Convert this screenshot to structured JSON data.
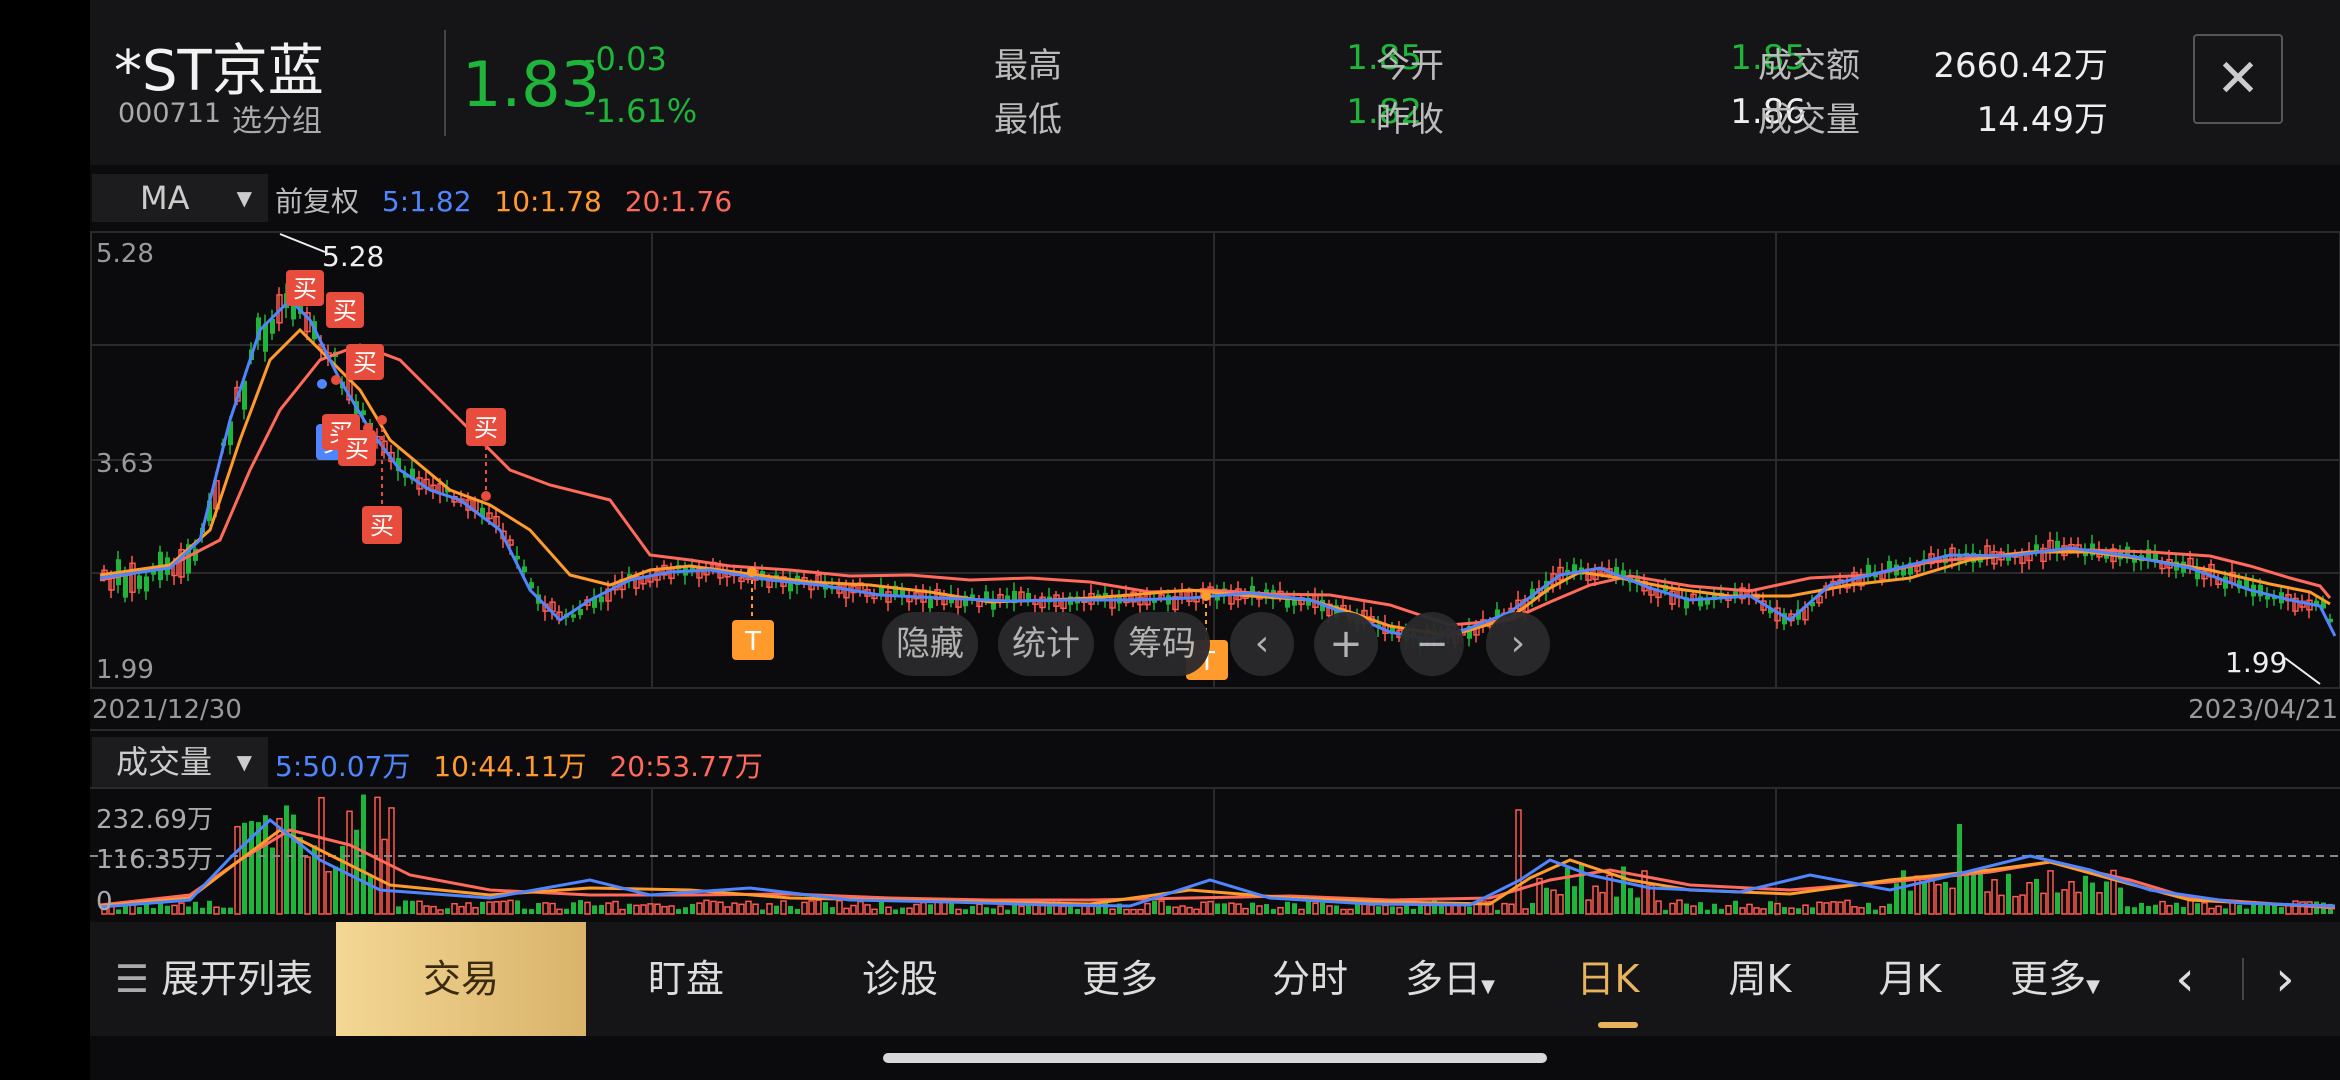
{
  "header": {
    "name": "*ST京蓝",
    "code": "000711",
    "group": "选分组",
    "price": "1.83",
    "change": "-0.03",
    "change_pct": "-1.61%",
    "high_label": "最高",
    "high": "1.85",
    "low_label": "最低",
    "low": "1.82",
    "open_label": "今开",
    "open": "1.85",
    "prev_close_label": "昨收",
    "prev_close": "1.86",
    "amount_label": "成交额",
    "amount": "2660.42万",
    "volume_label": "成交量",
    "volume": "14.49万",
    "close_symbol": "✕"
  },
  "ma_bar": {
    "select": "MA",
    "adjust": "前复权",
    "ma5": "5:1.82",
    "ma10": "10:1.78",
    "ma20": "20:1.76"
  },
  "kline": {
    "y_top": "5.28",
    "y_mid": "3.63",
    "y_bottom": "1.99",
    "max_marker": "5.28",
    "min_marker": "1.99",
    "date_start": "2021/12/30",
    "date_end": "2023/04/21",
    "buy_label": "买",
    "t_label": "T"
  },
  "controls": {
    "hide": "隐藏",
    "stats": "统计",
    "chips": "筹码"
  },
  "volume_bar": {
    "select": "成交量",
    "ma5": "5:50.07万",
    "ma10": "10:44.11万",
    "ma20": "20:53.77万",
    "y_top": "232.69万",
    "y_mid": "116.35万",
    "y_zero": "0"
  },
  "bottom_nav": {
    "expand": "展开列表",
    "trade": "交易",
    "watch": "盯盘",
    "diagnose": "诊股",
    "more1": "更多",
    "intraday": "分时",
    "multiday": "多日",
    "daily": "日K",
    "weekly": "周K",
    "monthly": "月K",
    "more2": "更多"
  },
  "colors": {
    "up": "#ff5a4e",
    "down": "#1fb53a",
    "ma5": "#4f86ff",
    "ma10": "#ff9b2c",
    "ma20": "#ff6a5a",
    "accent": "#e7b35d"
  },
  "icons": [
    "close-icon",
    "dropdown-arrow-icon",
    "list-icon",
    "chevron-left-icon",
    "chevron-right-icon",
    "plus-icon",
    "minus-icon"
  ]
}
